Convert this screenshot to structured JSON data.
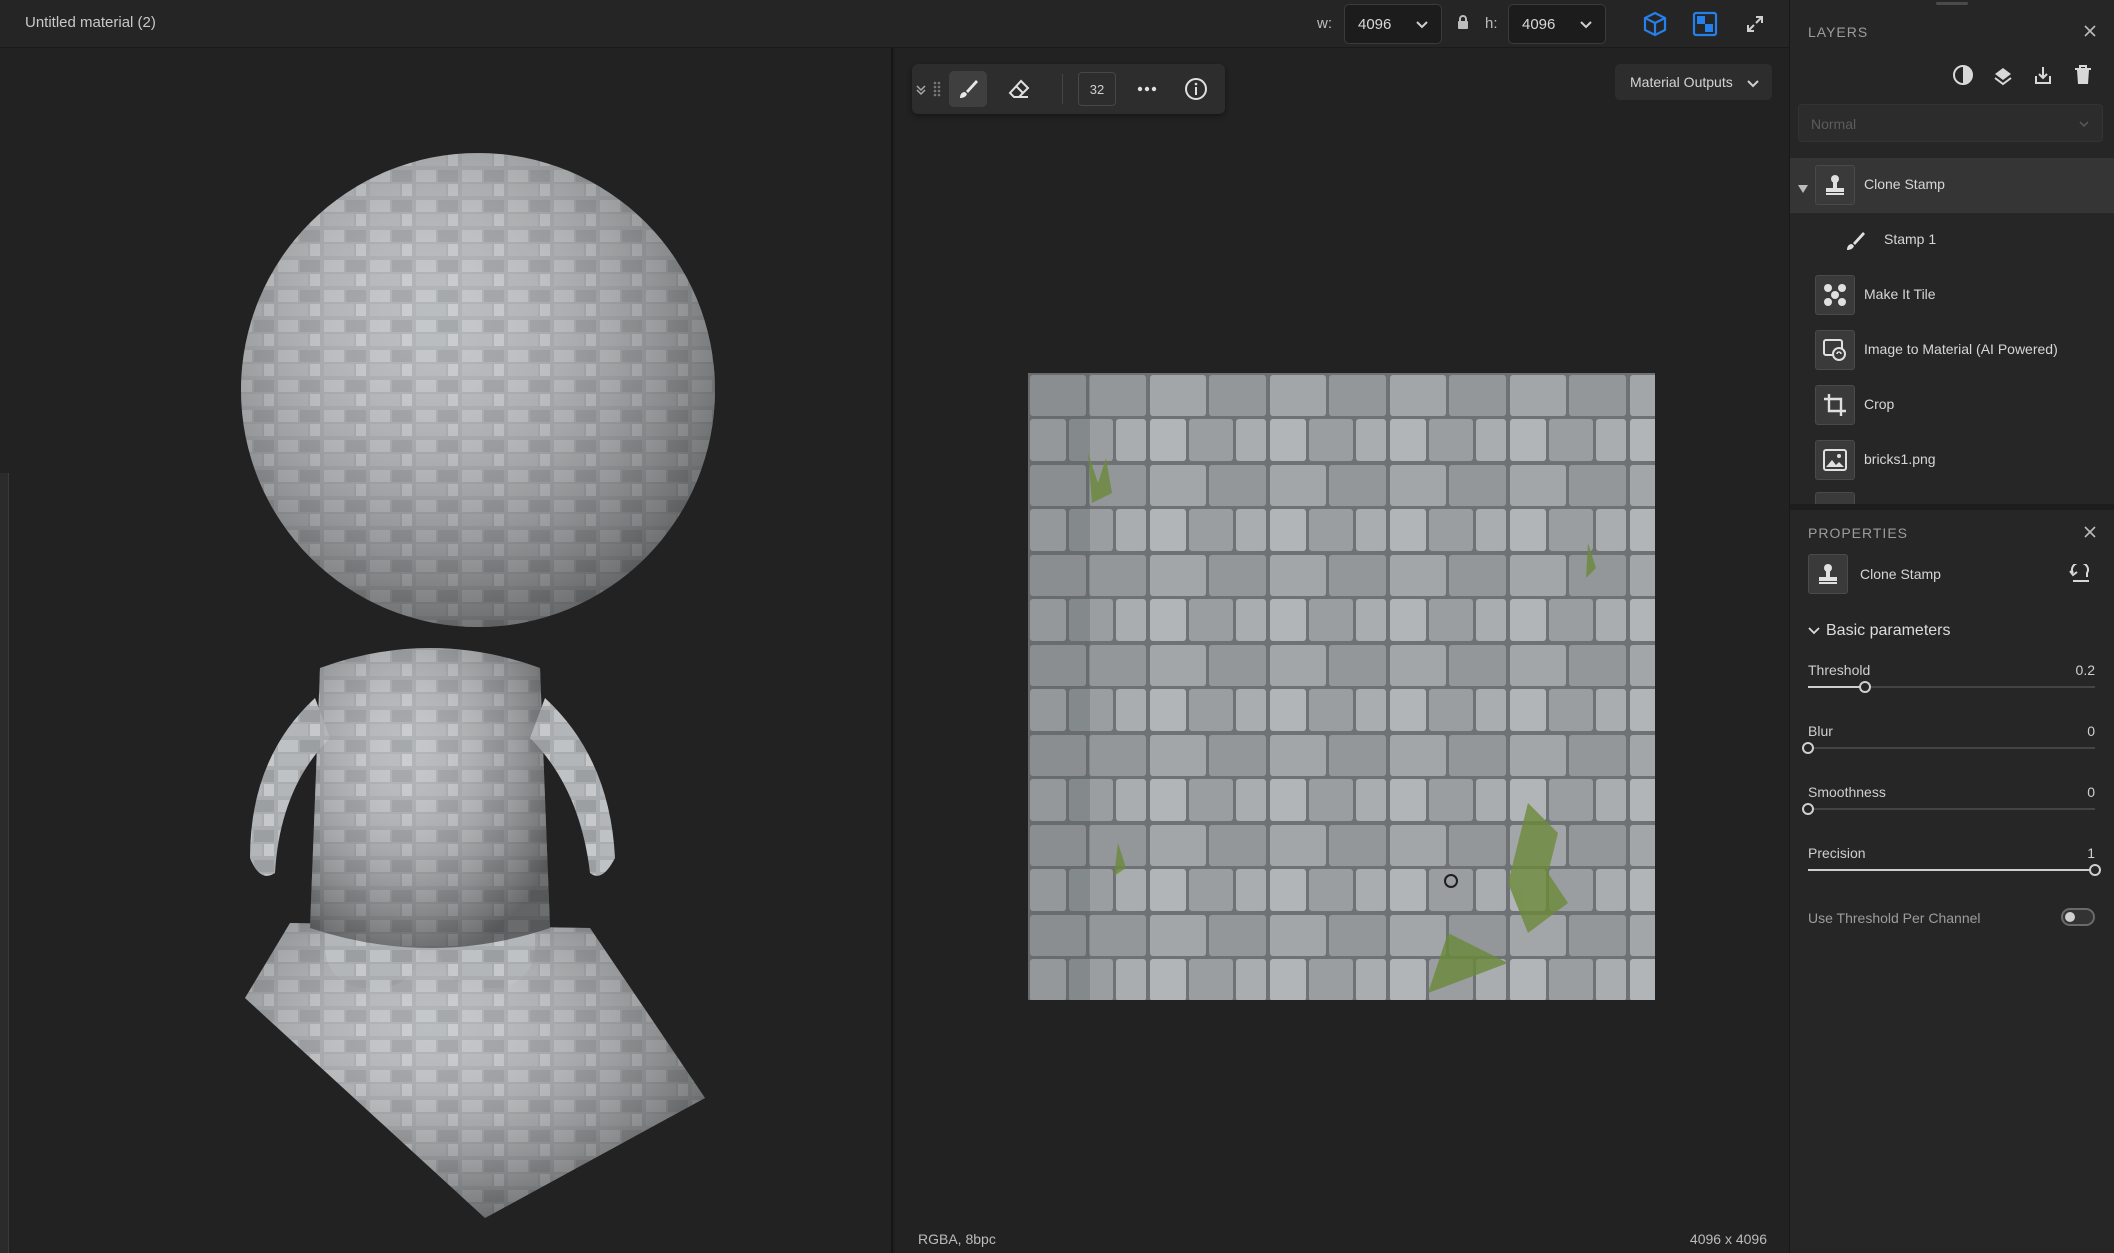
{
  "header": {
    "doc_title": "Untitled material (2)",
    "width_label": "w:",
    "width_value": "4096",
    "height_label": "h:",
    "height_value": "4096"
  },
  "toolbar": {
    "brush_size": "32",
    "material_outputs": "Material Outputs"
  },
  "canvas": {
    "status_left": "RGBA, 8bpc",
    "status_right": "4096 x 4096"
  },
  "layers_panel": {
    "title": "LAYERS",
    "blend_mode": "Normal",
    "items": [
      {
        "name": "Clone Stamp",
        "icon": "stamp-icon",
        "selected": true
      },
      {
        "name": "Stamp 1",
        "icon": "brush-icon",
        "child": true
      },
      {
        "name": "Make It Tile",
        "icon": "tile-icon"
      },
      {
        "name": "Image to Material (AI Powered)",
        "icon": "ai-material-icon"
      },
      {
        "name": "Crop",
        "icon": "crop-icon"
      },
      {
        "name": "bricks1.png",
        "icon": "image-icon"
      }
    ]
  },
  "properties_panel": {
    "title": "PROPERTIES",
    "layer_name": "Clone Stamp",
    "section": "Basic parameters",
    "params": [
      {
        "label": "Threshold",
        "value": "0.2",
        "fraction": 0.2
      },
      {
        "label": "Blur",
        "value": "0",
        "fraction": 0
      },
      {
        "label": "Smoothness",
        "value": "0",
        "fraction": 0
      },
      {
        "label": "Precision",
        "value": "1",
        "fraction": 1
      }
    ],
    "toggle_label": "Use Threshold Per Channel",
    "toggle_on": false
  },
  "colors": {
    "accent": "#2680eb",
    "background": "#222222",
    "panel": "#262626"
  }
}
